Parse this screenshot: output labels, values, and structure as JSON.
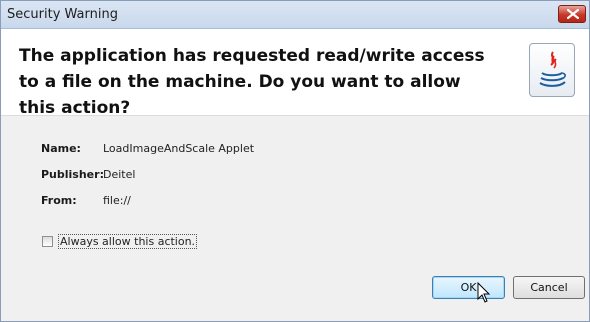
{
  "window": {
    "title": "Security Warning"
  },
  "header": {
    "message": "The application has requested read/write access to a file on the machine.  Do you want to allow this action?",
    "icon": "java-icon"
  },
  "details": [
    {
      "label": "Name:",
      "value": "LoadImageAndScale Applet"
    },
    {
      "label": "Publisher:",
      "value": "Deitel"
    },
    {
      "label": "From:",
      "value": "file://"
    }
  ],
  "checkbox": {
    "label": "Always allow this action.",
    "checked": false
  },
  "buttons": {
    "ok_label": "OK",
    "cancel_label": "Cancel"
  },
  "colors": {
    "title_bar": "#c8d8ec",
    "close_button": "#c7382a",
    "ok_button_border": "#3c7fb1"
  }
}
